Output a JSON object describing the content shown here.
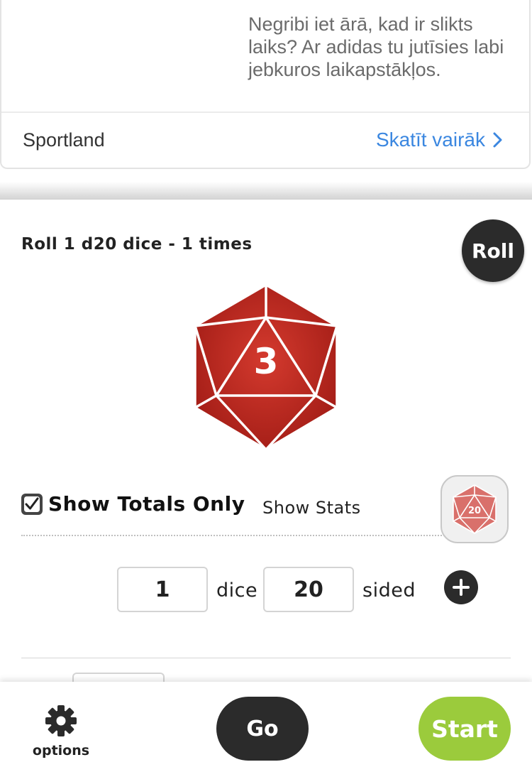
{
  "ad": {
    "text": "Negribi iet ārā, kad ir slikts laiks? Ar adidas tu jutīsies labi jebkuros laikapstākļos.",
    "brand": "Sportland",
    "more_label": "Skatīt vairāk"
  },
  "roller": {
    "title": "Roll 1 d20 dice - 1 times",
    "roll_label": "Roll",
    "result": "3",
    "die_color": "#b5221c",
    "show_totals_label": "Show Totals Only",
    "show_totals_checked": true,
    "show_stats_label": "Show Stats",
    "selected_die_label": "20",
    "dice_count": "1",
    "dice_label": "dice",
    "sides": "20",
    "sided_label": "sided"
  },
  "bottom_bar": {
    "options_label": "options",
    "go_label": "Go",
    "start_label": "Start",
    "start_color": "#9bcb3c"
  }
}
